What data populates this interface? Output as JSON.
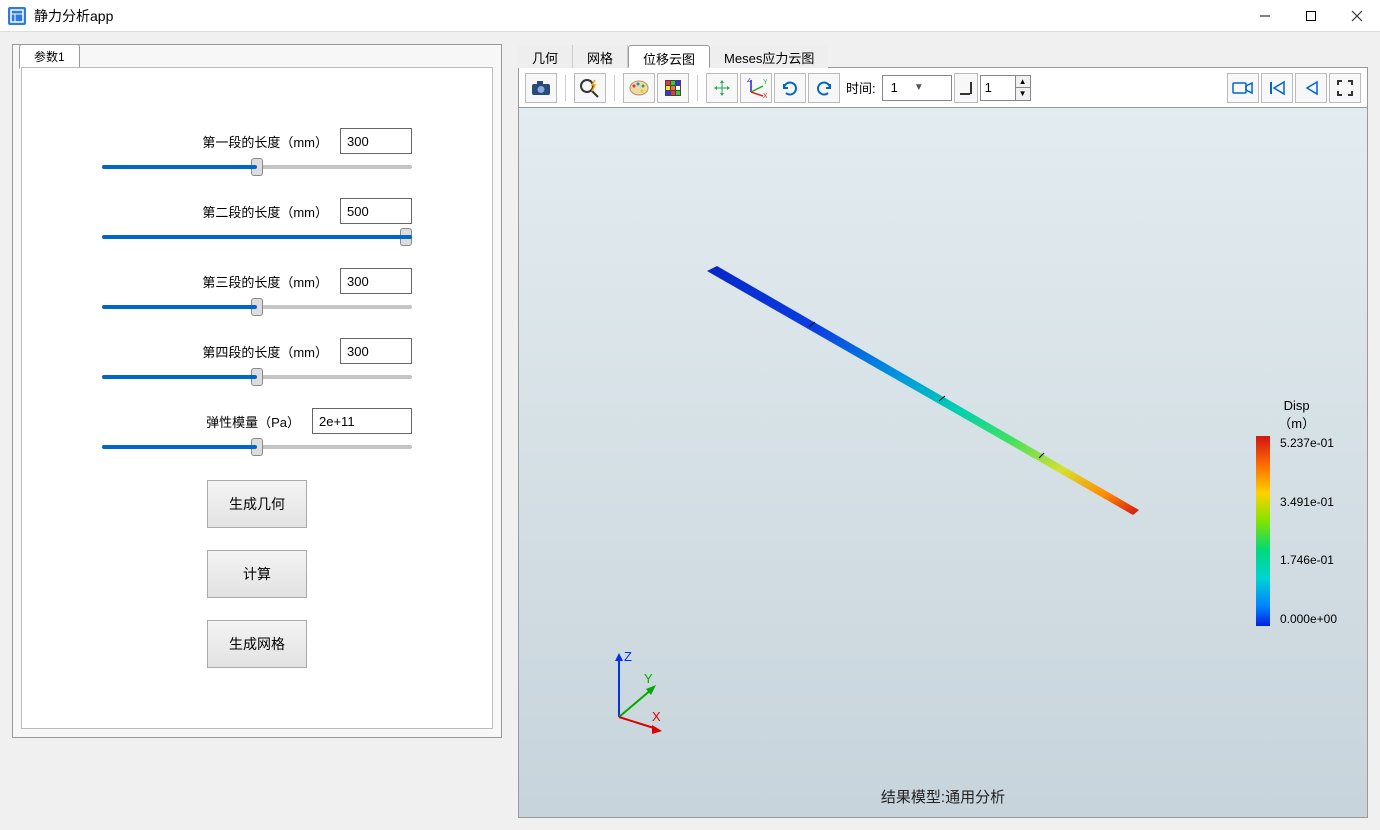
{
  "app": {
    "title": "静力分析app"
  },
  "panel": {
    "tab": "参数1",
    "p1_label": "第一段的长度（mm）",
    "p1_value": "300",
    "p2_label": "第二段的长度（mm）",
    "p2_value": "500",
    "p3_label": "第三段的长度（mm）",
    "p3_value": "300",
    "p4_label": "第四段的长度（mm）",
    "p4_value": "300",
    "p5_label": "弹性模量（Pa）",
    "p5_value": "2e+11",
    "btn_geom": "生成几何",
    "btn_calc": "计算",
    "btn_mesh": "生成网格"
  },
  "viz": {
    "tab1": "几何",
    "tab2": "网格",
    "tab3": "位移云图",
    "tab4": "Meses应力云图",
    "time_label": "时间:",
    "time_value": "1",
    "frame_value": "1",
    "legend_title1": "Disp",
    "legend_title2": "（m）",
    "tick1": "5.237e-01",
    "tick2": "3.491e-01",
    "tick3": "1.746e-01",
    "tick4": "0.000e+00",
    "caption": "结果模型:通用分析",
    "axis_x": "X",
    "axis_y": "Y",
    "axis_z": "Z"
  }
}
